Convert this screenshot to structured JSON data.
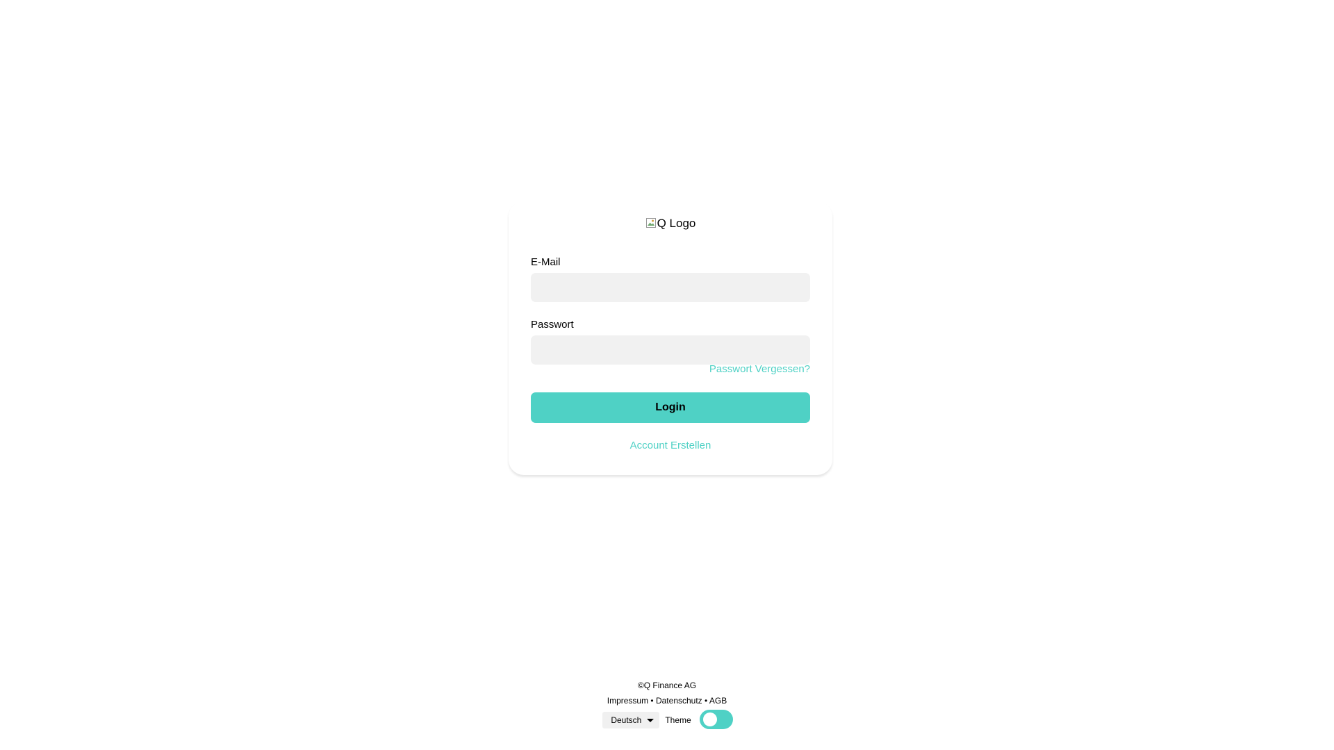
{
  "logo": {
    "alt_text": "Q Logo"
  },
  "form": {
    "email_label": "E-Mail",
    "email_value": "",
    "password_label": "Passwort",
    "password_value": "",
    "forgot_password": "Passwort Vergessen?",
    "login_button": "Login",
    "create_account": "Account Erstellen"
  },
  "footer": {
    "copyright": "©Q Finance AG",
    "links": [
      "Impressum",
      "Datenschutz",
      "AGB"
    ],
    "separator": " • ",
    "language": "Deutsch",
    "theme_label": "Theme",
    "theme_toggle_on": true
  },
  "colors": {
    "accent": "#4fd1c5",
    "input_background": "#f1f1f1"
  },
  "icons": {
    "logo": "broken-image-icon",
    "language_dropdown": "caret-down-icon"
  }
}
